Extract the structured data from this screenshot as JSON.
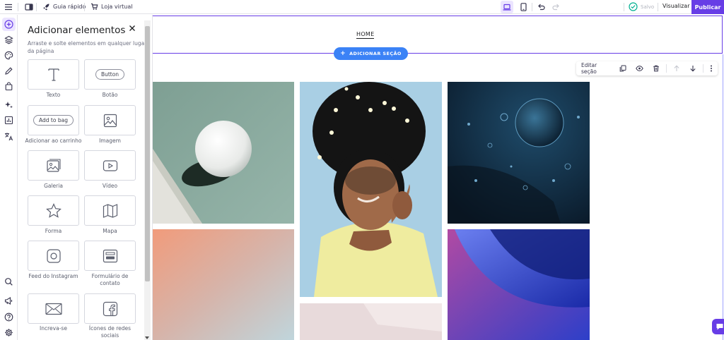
{
  "topbar": {
    "quick_guide": "Guia rápido",
    "online_store": "Loja virtual",
    "saved": "Salvo",
    "preview": "Visualizar",
    "publish": "Publicar"
  },
  "panel": {
    "title": "Adicionar elementos",
    "subtitle": "Arraste e solte elementos em qualquer lugar da página",
    "elements": [
      {
        "label": "Texto",
        "icon": "text-icon"
      },
      {
        "label": "Botão",
        "icon": "button-pill",
        "pill": "Button"
      },
      {
        "label": "Adicionar ao carrinho",
        "icon": "add-to-bag-pill",
        "pill": "Add to bag"
      },
      {
        "label": "Imagem",
        "icon": "image-icon"
      },
      {
        "label": "Galeria",
        "icon": "gallery-icon"
      },
      {
        "label": "Vídeo",
        "icon": "video-icon"
      },
      {
        "label": "Forma",
        "icon": "star-icon"
      },
      {
        "label": "Mapa",
        "icon": "map-icon"
      },
      {
        "label": "Feed do Instagram",
        "icon": "instagram-icon"
      },
      {
        "label": "Formulário de contato",
        "icon": "form-icon"
      },
      {
        "label": "Increva-se",
        "icon": "envelope-icon"
      },
      {
        "label": "Ícones de redes sociais",
        "icon": "facebook-icon"
      }
    ]
  },
  "canvas": {
    "nav_home": "HOME",
    "add_section": "ADICIONAR SEÇÃO",
    "edit_section": "Editar seção"
  },
  "colors": {
    "brand": "#673de6",
    "accent_blue": "#3b82f6",
    "saved_green": "#00b090"
  }
}
